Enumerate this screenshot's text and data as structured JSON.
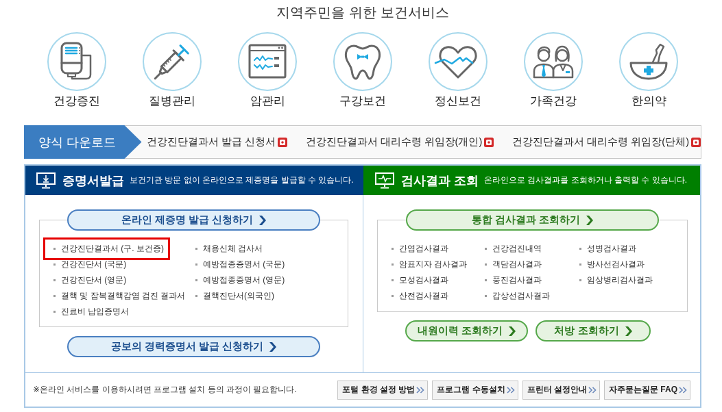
{
  "title": "지역주민을 위한 보건서비스",
  "services": [
    {
      "label": "건강증진",
      "kind": "infusion"
    },
    {
      "label": "질병관리",
      "kind": "syringe"
    },
    {
      "label": "암관리",
      "kind": "monitor"
    },
    {
      "label": "구강보건",
      "kind": "tooth"
    },
    {
      "label": "정신보건",
      "kind": "heart"
    },
    {
      "label": "가족건강",
      "kind": "family"
    },
    {
      "label": "한의약",
      "kind": "mortar"
    }
  ],
  "form_download": {
    "label": "양식 다운로드",
    "files": [
      "건강진단결과서 발급 신청서",
      "건강진단결과서 대리수령 위임장(개인)",
      "건강진단결과서 대리수령 위임장(단체)"
    ]
  },
  "certificates": {
    "title": "증명서발급",
    "description": "보건기관 방문 없이 온라인으로 제증명을 발급할 수 있습니다.",
    "apply_button": "온라인 제증명 발급 신청하기",
    "items": [
      {
        "label": "건강진단결과서 (구. 보건증)",
        "highlighted": true
      },
      {
        "label": "채용신체 검사서",
        "highlighted": false
      },
      {
        "label": "건강진단서 (국문)",
        "highlighted": false
      },
      {
        "label": "예방접종증명서 (국문)",
        "highlighted": false
      },
      {
        "label": "건강진단서 (영문)",
        "highlighted": false
      },
      {
        "label": "예방접종증명서 (영문)",
        "highlighted": false
      },
      {
        "label": "결핵 및 잠복결핵감염 검진 결과서",
        "highlighted": false
      },
      {
        "label": "결핵진단서(외국인)",
        "highlighted": false
      },
      {
        "label": "진료비 납입증명서",
        "highlighted": false
      }
    ],
    "career_button": "공보의 경력증명서 발급 신청하기"
  },
  "results": {
    "title": "검사결과 조회",
    "description": "온라인으로 검사결과를 조회하거나 출력할 수 있습니다.",
    "lookup_button": "통합 검사결과 조회하기",
    "items": [
      "간염검사결과",
      "건강검진내역",
      "성병검사결과",
      "암표지자 검사결과",
      "객담검사결과",
      "방사선검사결과",
      "모성검사결과",
      "풍진검사결과",
      "임상병리검사결과",
      "산전검사결과",
      "갑상선검사결과"
    ],
    "buttons": [
      "내원이력 조회하기",
      "처방 조회하기"
    ]
  },
  "footer": {
    "notice": "※온라인 서비스를 이용하시려면 프로그램 설치 등의 과정이 필요합니다.",
    "buttons": [
      "포털 환경 설정 방법",
      "프로그램 수동설치",
      "프린터 설정안내",
      "자주묻는질문 FAQ"
    ]
  }
}
